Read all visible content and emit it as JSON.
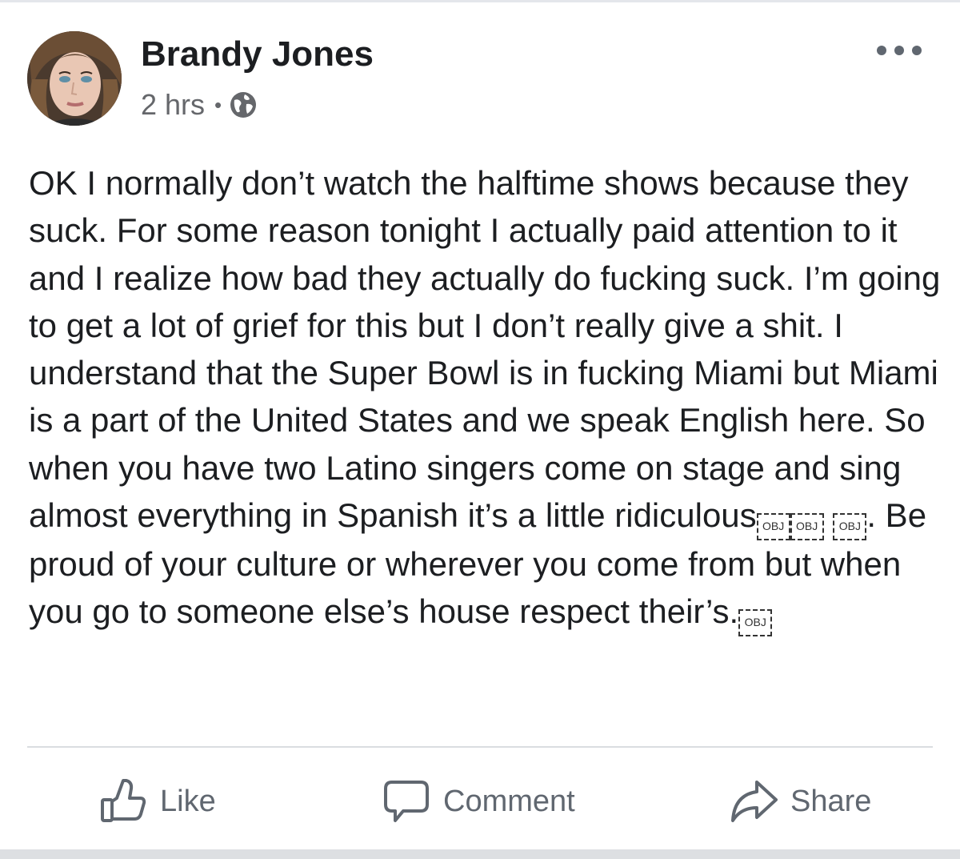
{
  "post": {
    "author": "Brandy Jones",
    "time": "2 hrs",
    "separator": "•",
    "privacy_icon": "globe-icon",
    "more_icon": "more-options-icon",
    "text_segments": [
      "OK I normally don’t watch the halftime shows because they suck. For some reason tonight I actually paid attention to it and I realize how bad they actually do fucking suck. I’m going to get a lot of grief for this but I don’t really give a shit. I understand that the Super Bowl is in fucking Miami but Miami is a part of the United States and we speak English here. So when you have two Latino singers come on stage and sing almost everything in Spanish it’s a little ridiculous",
      ". Be proud of your culture or wherever you come from but when you go to someone else’s house respect their’s."
    ],
    "obj_placeholder": "OBJ"
  },
  "actions": {
    "like": "Like",
    "comment": "Comment",
    "share": "Share"
  },
  "colors": {
    "text": "#1c1e21",
    "secondary": "#65676b",
    "action": "#606770",
    "divider": "#dadde1"
  }
}
